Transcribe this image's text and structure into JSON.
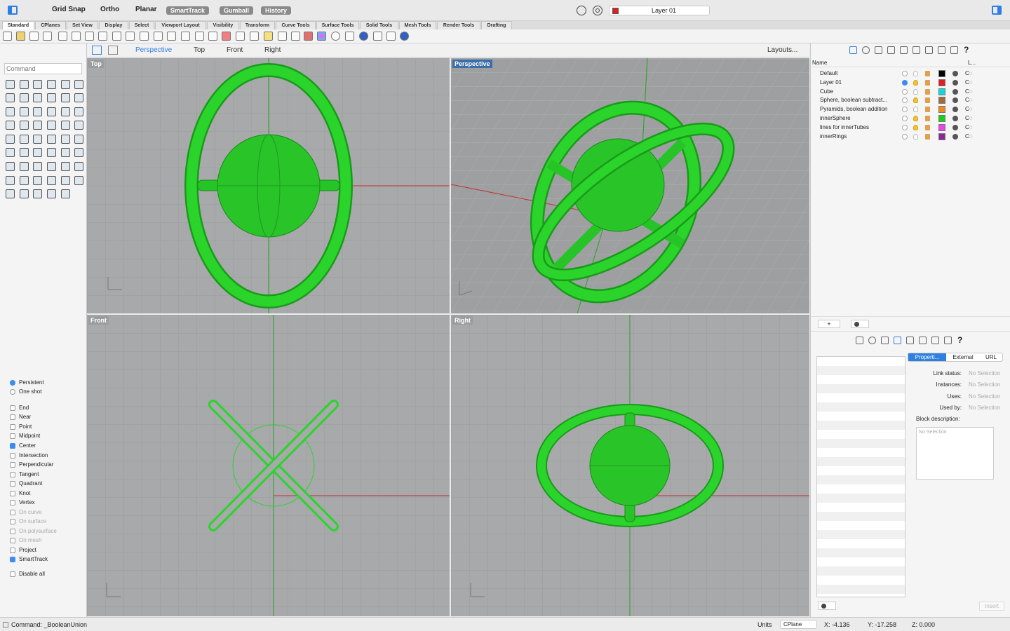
{
  "titlebar": {
    "grid_snap": "Grid Snap",
    "ortho": "Ortho",
    "planar": "Planar",
    "smarttrack": "SmartTrack",
    "gumball": "Gumball",
    "history": "History",
    "layer": "Layer 01",
    "layer_color": "#e02020"
  },
  "tabs": [
    "Standard",
    "CPlanes",
    "Set View",
    "Display",
    "Select",
    "Viewport Layout",
    "Visibility",
    "Transform",
    "Curve Tools",
    "Surface Tools",
    "Solid Tools",
    "Mesh Tools",
    "Render Tools",
    "Drafting"
  ],
  "command": {
    "placeholder": "Command"
  },
  "viewbar": {
    "tabs": [
      "Perspective",
      "Top",
      "Front",
      "Right"
    ],
    "layouts": "Layouts..."
  },
  "viewports": {
    "top": "Top",
    "perspective": "Perspective",
    "front": "Front",
    "right": "Right"
  },
  "osnap": {
    "persistent": "Persistent",
    "one_shot": "One shot",
    "items": [
      {
        "label": "End",
        "on": false,
        "enabled": true
      },
      {
        "label": "Near",
        "on": false,
        "enabled": true
      },
      {
        "label": "Point",
        "on": false,
        "enabled": true
      },
      {
        "label": "Midpoint",
        "on": false,
        "enabled": true
      },
      {
        "label": "Center",
        "on": true,
        "enabled": true
      },
      {
        "label": "Intersection",
        "on": false,
        "enabled": true
      },
      {
        "label": "Perpendicular",
        "on": false,
        "enabled": true
      },
      {
        "label": "Tangent",
        "on": false,
        "enabled": true
      },
      {
        "label": "Quadrant",
        "on": false,
        "enabled": true
      },
      {
        "label": "Knot",
        "on": false,
        "enabled": true
      },
      {
        "label": "Vertex",
        "on": false,
        "enabled": true
      },
      {
        "label": "On curve",
        "on": false,
        "enabled": false
      },
      {
        "label": "On surface",
        "on": false,
        "enabled": false
      },
      {
        "label": "On polysurface",
        "on": false,
        "enabled": false
      },
      {
        "label": "On mesh",
        "on": false,
        "enabled": false
      },
      {
        "label": "Project",
        "on": false,
        "enabled": true
      },
      {
        "label": "SmartTrack",
        "on": true,
        "enabled": true
      }
    ],
    "disable_all": "Disable all"
  },
  "layers": {
    "header_name": "Name",
    "header_l": "L...",
    "rows": [
      {
        "name": "Default",
        "color": "#000000",
        "current": false,
        "on": false
      },
      {
        "name": "Layer 01",
        "color": "#e02020",
        "current": true,
        "on": true
      },
      {
        "name": "Cube",
        "color": "#10d8e0",
        "current": false,
        "on": false
      },
      {
        "name": "Sphere, boolean subtract...",
        "color": "#a06a3a",
        "current": false,
        "on": true
      },
      {
        "name": "Pyramids, boolean addition",
        "color": "#f08a1a",
        "current": false,
        "on": false
      },
      {
        "name": "innerSphere",
        "color": "#18d018",
        "current": false,
        "on": true
      },
      {
        "name": "lines for innerTubes",
        "color": "#f040f0",
        "current": false,
        "on": true
      },
      {
        "name": "innerRings",
        "color": "#8a2a9a",
        "current": false,
        "on": false
      }
    ],
    "linetype": "C◌"
  },
  "props": {
    "tabs": [
      "Properti...",
      "External",
      "URL"
    ],
    "link_status": "Link status:",
    "instances": "Instances:",
    "uses": "Uses:",
    "used_by": "Used by:",
    "no_selection": "No Selection",
    "block_description": "Block description:",
    "insert": "Insert"
  },
  "status": {
    "command": "Command: _BooleanUnion",
    "units": "Units",
    "cplane": "CPlane",
    "x": "X: -4.136",
    "y": "Y: -17.258",
    "z": "Z: 0.000"
  },
  "green": "#2bd42b"
}
